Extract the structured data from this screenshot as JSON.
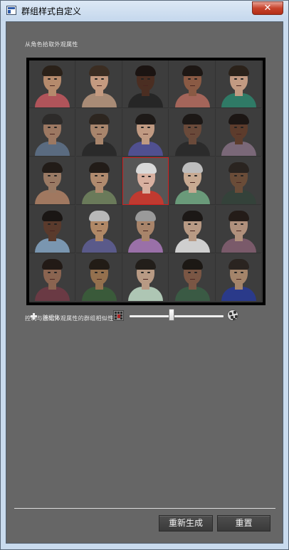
{
  "window": {
    "title": "群组样式自定义",
    "close_label": "✕"
  },
  "picker": {
    "label": "从角色拾取外观属性",
    "selected": {
      "row": 2,
      "col": 2
    },
    "rows": [
      [
        {
          "skin": "#b58a6c",
          "hair": "#2a2119",
          "shirt": "#b0545a"
        },
        {
          "skin": "#c49a80",
          "hair": "#3b2d22",
          "shirt": "#a88b76"
        },
        {
          "skin": "#4b2e22",
          "hair": "#1b1412",
          "shirt": "#262626"
        },
        {
          "skin": "#8a5a44",
          "hair": "#1d1714",
          "shirt": "#a4655a"
        },
        {
          "skin": "#c29a82",
          "hair": "#2b221a",
          "shirt": "#2f7a66"
        }
      ],
      [
        {
          "skin": "#9c7862",
          "hair": "#2d2b2a",
          "shirt": "#5a6b80"
        },
        {
          "skin": "#a8856c",
          "hair": "#2d2620",
          "shirt": "#2a2a2a"
        },
        {
          "skin": "#c09a82",
          "hair": "#1e1a18",
          "shirt": "#505090"
        },
        {
          "skin": "#6a4a3a",
          "hair": "#1c1816",
          "shirt": "#2b2b2b"
        },
        {
          "skin": "#5d3c2c",
          "hair": "#1c1614",
          "shirt": "#7a6878"
        }
      ],
      [
        {
          "skin": "#9a7a64",
          "hair": "#221c18",
          "shirt": "#a07860"
        },
        {
          "skin": "#b08a6e",
          "hair": "#221c18",
          "shirt": "#6a7a5a"
        },
        {
          "skin": "#d8b0a0",
          "hair": "#d9d9d9",
          "shirt": "#c03a30"
        },
        {
          "skin": "#c8aa92",
          "hair": "#bdbdbd",
          "shirt": "#6a9a7a"
        },
        {
          "skin": "#6a4c38",
          "hair": "#2a2420",
          "shirt": "#34423a"
        }
      ],
      [
        {
          "skin": "#5a3a2c",
          "hair": "#1a1614",
          "shirt": "#7a96b0"
        },
        {
          "skin": "#b08866",
          "hair": "#b8b8b8",
          "shirt": "#5a5a8a"
        },
        {
          "skin": "#a8846a",
          "hair": "#9a9a9a",
          "shirt": "#9a70a8"
        },
        {
          "skin": "#b89a84",
          "hair": "#1c1816",
          "shirt": "#cfcfcf"
        },
        {
          "skin": "#b0907c",
          "hair": "#241c18",
          "shirt": "#7a5a6a"
        }
      ],
      [
        {
          "skin": "#8a6450",
          "hair": "#221a16",
          "shirt": "#6a3a44"
        },
        {
          "skin": "#94704e",
          "hair": "#221c16",
          "shirt": "#3a5a3a"
        },
        {
          "skin": "#b89a84",
          "hair": "#221e1a",
          "shirt": "#aec6b4"
        },
        {
          "skin": "#7a5644",
          "hair": "#1c1814",
          "shirt": "#3a5a44"
        },
        {
          "skin": "#a4846a",
          "hair": "#2a2420",
          "shirt": "#2a3a8a"
        }
      ]
    ]
  },
  "similarity": {
    "label": "控制与选定外观属性的群组相似性",
    "randomize_label": "随机化",
    "value_fraction": 0.45,
    "left_icon": "similar-crowd-icon",
    "right_icon": "varied-crowd-icon"
  },
  "buttons": {
    "regenerate": "重新生成",
    "reset": "重置"
  },
  "colors": {
    "panel_bg": "#666666",
    "selection": "#d02020",
    "button_bg": "#444444"
  }
}
